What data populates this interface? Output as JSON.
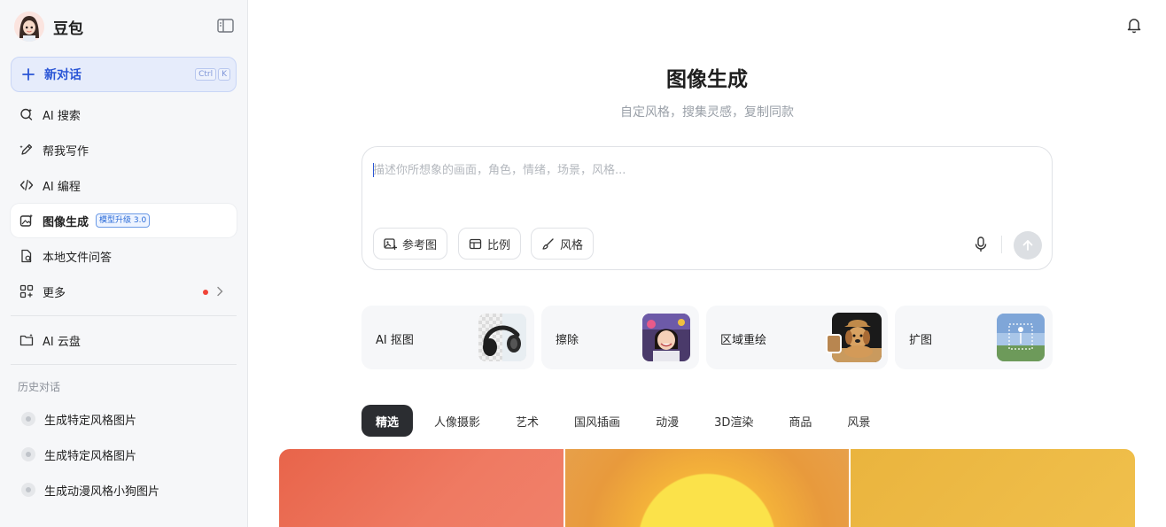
{
  "sidebar": {
    "brand_name": "豆包",
    "new_chat": {
      "label": "新对话",
      "shortcut": [
        "Ctrl",
        "K"
      ]
    },
    "nav": [
      {
        "id": "ai-search",
        "label": "AI 搜索",
        "icon": "search-sparkle-icon"
      },
      {
        "id": "writing",
        "label": "帮我写作",
        "icon": "pen-icon"
      },
      {
        "id": "coding",
        "label": "AI 编程",
        "icon": "code-icon"
      },
      {
        "id": "image-gen",
        "label": "图像生成",
        "icon": "image-gen-icon",
        "badge": "模型升级 3.0",
        "active": true
      },
      {
        "id": "local-file-qa",
        "label": "本地文件问答",
        "icon": "file-icon"
      },
      {
        "id": "more",
        "label": "更多",
        "icon": "grid-icon",
        "has_dot": true
      }
    ],
    "cloud": {
      "label": "AI 云盘",
      "icon": "cloud-folder-icon"
    },
    "history_title": "历史对话",
    "history": [
      "生成特定风格图片",
      "生成特定风格图片",
      "生成动漫风格小狗图片"
    ]
  },
  "main": {
    "title": "图像生成",
    "subtitle": "自定风格，搜集灵感，复制同款",
    "prompt": {
      "placeholder": "描述你所想象的画面，角色，情绪，场景，风格...",
      "value": "",
      "tools": [
        {
          "id": "reference",
          "label": "参考图",
          "icon": "image-plus-icon"
        },
        {
          "id": "ratio",
          "label": "比例",
          "icon": "ratio-icon"
        },
        {
          "id": "style",
          "label": "风格",
          "icon": "brush-icon"
        }
      ]
    },
    "features": [
      {
        "id": "cutout",
        "label": "AI 抠图"
      },
      {
        "id": "erase",
        "label": "擦除"
      },
      {
        "id": "inpaint",
        "label": "区域重绘"
      },
      {
        "id": "expand",
        "label": "扩图"
      }
    ],
    "tabs": [
      {
        "label": "精选",
        "active": true
      },
      {
        "label": "人像摄影"
      },
      {
        "label": "艺术"
      },
      {
        "label": "国风插画"
      },
      {
        "label": "动漫"
      },
      {
        "label": "3D渲染"
      },
      {
        "label": "商品"
      },
      {
        "label": "风景"
      }
    ]
  },
  "colors": {
    "accent": "#2a55d6",
    "sidebar_bg": "#f6f7f9",
    "active_tab_bg": "#2b2d31",
    "notification_dot": "#f04438"
  }
}
